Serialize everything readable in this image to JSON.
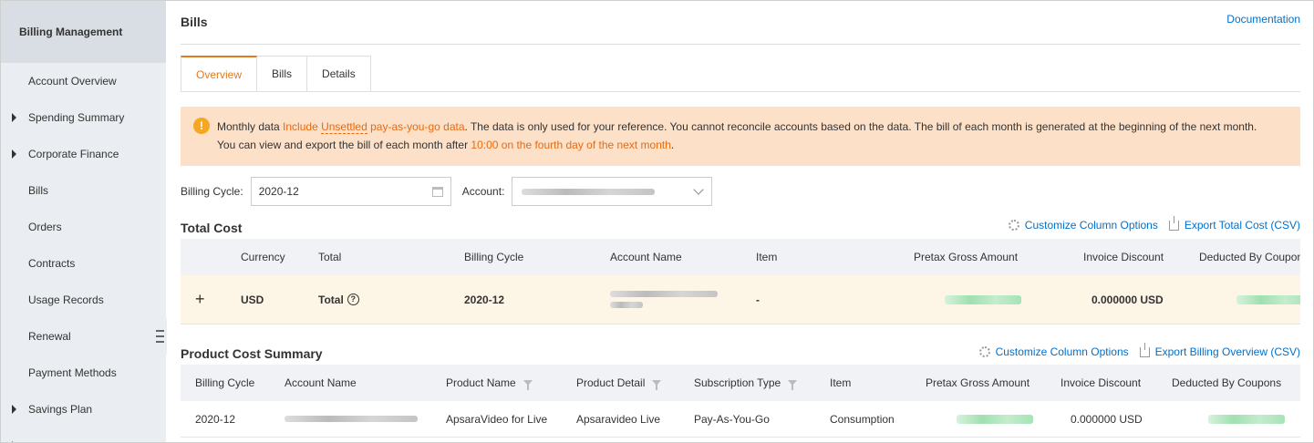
{
  "sidebar": {
    "header": "Billing Management",
    "items": [
      {
        "label": "Account Overview",
        "expandable": false
      },
      {
        "label": "Spending Summary",
        "expandable": true
      },
      {
        "label": "Corporate Finance",
        "expandable": true
      },
      {
        "label": "Bills",
        "expandable": false
      },
      {
        "label": "Orders",
        "expandable": false
      },
      {
        "label": "Contracts",
        "expandable": false
      },
      {
        "label": "Usage Records",
        "expandable": false
      },
      {
        "label": "Renewal",
        "expandable": false
      },
      {
        "label": "Payment Methods",
        "expandable": false
      },
      {
        "label": "Savings Plan",
        "expandable": true
      }
    ]
  },
  "header": {
    "title": "Bills",
    "doc_link": "Documentation"
  },
  "tabs": [
    {
      "label": "Overview",
      "active": true
    },
    {
      "label": "Bills",
      "active": false
    },
    {
      "label": "Details",
      "active": false
    }
  ],
  "notice": {
    "icon": "info-icon",
    "t1": "Monthly data ",
    "t2": "Include ",
    "t3": "Unsettled",
    "t4": " pay-as-you-go data",
    "t5": ". The data is only used for your reference. You cannot reconcile accounts based on the data. The bill of each month is generated at the beginning of the next month.",
    "t6": "You can view and export the bill of each month after ",
    "t7": "10:00 on the fourth day of the next month",
    "t8": "."
  },
  "filters": {
    "billing_cycle_label": "Billing Cycle:",
    "billing_cycle_value": "2020-12",
    "account_label": "Account:"
  },
  "total_cost": {
    "title": "Total Cost",
    "customize": "Customize Column Options",
    "export": "Export Total Cost (CSV)",
    "columns": [
      "Currency",
      "Total",
      "Billing Cycle",
      "Account Name",
      "Item",
      "Pretax Gross Amount",
      "Invoice Discount",
      "Deducted By Coupons"
    ],
    "row": {
      "currency": "USD",
      "total": "Total",
      "billing_cycle": "2020-12",
      "item": "-",
      "invoice_discount": "0.000000 USD"
    }
  },
  "product_summary": {
    "title": "Product Cost Summary",
    "customize": "Customize Column Options",
    "export": "Export Billing Overview (CSV)",
    "columns": [
      "Billing Cycle",
      "Account Name",
      "Product Name",
      "Product Detail",
      "Subscription Type",
      "Item",
      "Pretax Gross Amount",
      "Invoice Discount",
      "Deducted By Coupons"
    ],
    "row": {
      "billing_cycle": "2020-12",
      "product_name": "ApsaraVideo for Live",
      "product_detail": "Apsaravideo Live",
      "subscription_type": "Pay-As-You-Go",
      "item": "Consumption",
      "invoice_discount": "0.000000 USD"
    }
  },
  "colors": {
    "accent": "#e07b1f",
    "link": "#0070cc",
    "notice_bg": "#fde0c8",
    "total_row_bg": "#fdf6e6",
    "sidebar_bg": "#eaedf1"
  }
}
